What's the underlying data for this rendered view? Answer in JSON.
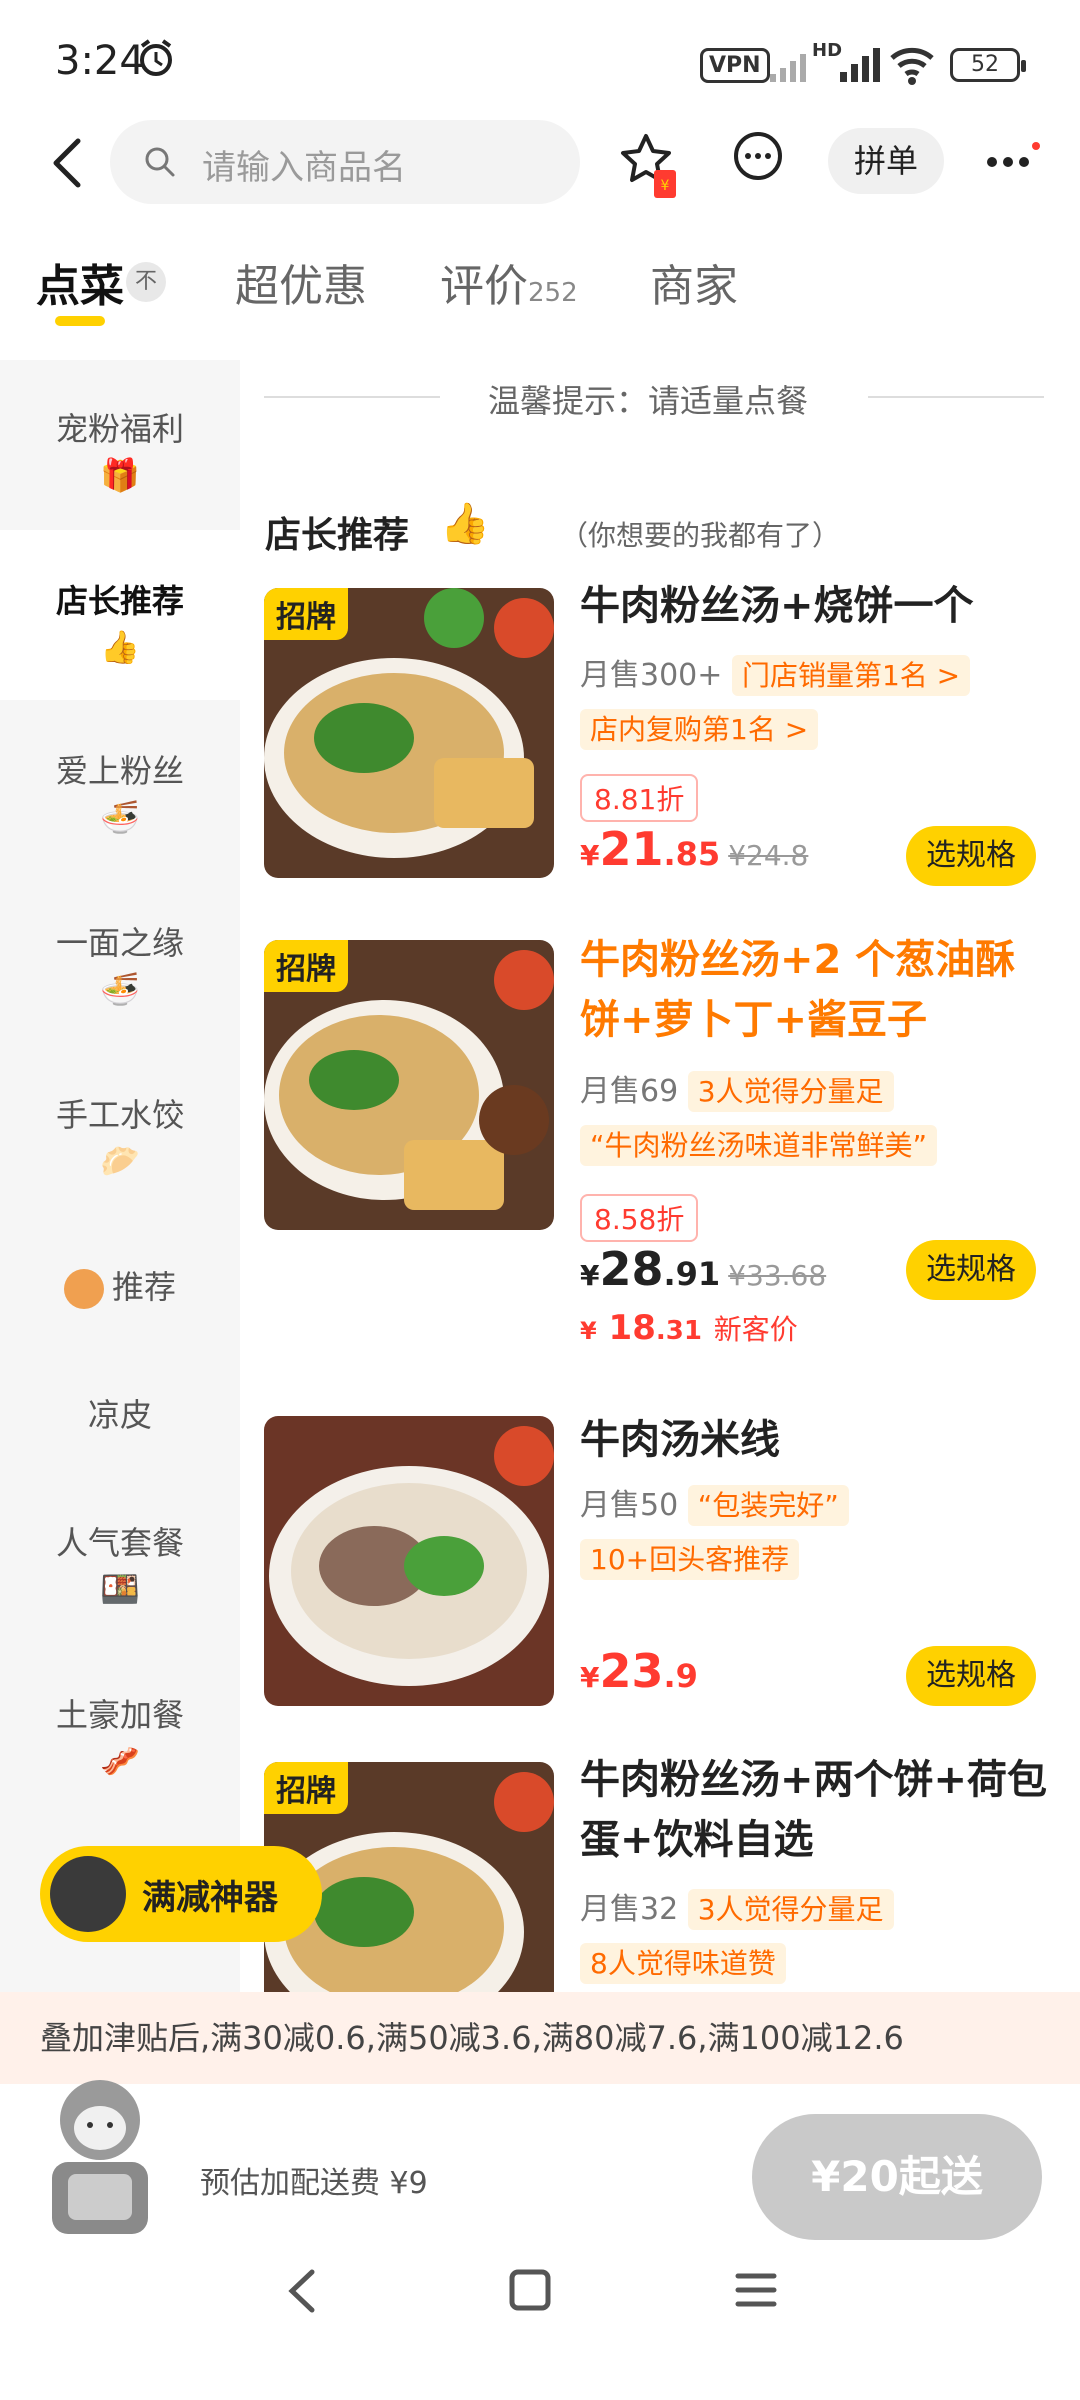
{
  "status_bar": {
    "time": "3:24",
    "vpn": "VPN",
    "hd": "HD",
    "battery": "52"
  },
  "header": {
    "search_placeholder": "请输入商品名",
    "pindan_label": "拼单"
  },
  "tabs": [
    {
      "label": "点菜",
      "active": true,
      "badge": "不"
    },
    {
      "label": "超优惠"
    },
    {
      "label": "评价",
      "count": "252"
    },
    {
      "label": "商家"
    }
  ],
  "sidebar": {
    "items": [
      {
        "label": "宠粉福利",
        "emoji": "🎁"
      },
      {
        "label": "店长推荐",
        "emoji": "👍",
        "active": true
      },
      {
        "label": "爱上粉丝",
        "emoji": "🍜"
      },
      {
        "label": "一面之缘",
        "emoji": "🍜"
      },
      {
        "label": "手工水饺",
        "emoji": "🥟"
      },
      {
        "label": "推荐"
      },
      {
        "label": "凉皮"
      },
      {
        "label": "人气套餐",
        "emoji": "🍱"
      },
      {
        "label": "土豪加餐",
        "emoji": "🥓"
      }
    ]
  },
  "content": {
    "tip": "温馨提示：请适量点餐",
    "section_title": "店长推荐",
    "section_emoji": "👍",
    "section_sub": "（你想要的我都有了）",
    "products": [
      {
        "tag": "招牌",
        "name": "牛肉粉丝汤+烧饼一个",
        "monthly": "月售300+",
        "chips": [
          "门店销量第1名 >",
          "店内复购第1名 >"
        ],
        "discount": "8.81折",
        "price_int": "21",
        "price_dec": ".85",
        "price_orig": "¥24.8",
        "button": "选规格"
      },
      {
        "tag": "招牌",
        "name": "牛肉粉丝汤+2 个葱油酥饼+萝卜丁+酱豆子",
        "monthly": "月售69",
        "chips": [
          "3人觉得分量足",
          "“牛肉粉丝汤味道非常鲜美”"
        ],
        "discount": "8.58折",
        "price_int": "28",
        "price_dec": ".91",
        "price_orig": "¥33.68",
        "new_int": "18",
        "new_dec": ".31",
        "new_label": "新客价",
        "button": "选规格"
      },
      {
        "name": "牛肉汤米线",
        "monthly": "月售50",
        "chips": [
          "“包装完好”",
          "10+回头客推荐"
        ],
        "price_int": "23",
        "price_dec": ".9",
        "button": "选规格"
      },
      {
        "tag": "招牌",
        "name": "牛肉粉丝汤+两个饼+荷包蛋+饮料自选",
        "monthly": "月售32",
        "chips": [
          "3人觉得分量足",
          "8人觉得味道赞"
        ]
      }
    ],
    "currency": "¥"
  },
  "fab": {
    "label": "满减神器"
  },
  "promo": {
    "text": "叠加津贴后,满30减0.6,满50减3.6,满80减7.6,满100减12.6"
  },
  "cart": {
    "fee": "预估加配送费 ¥9",
    "min_order": "¥20起送"
  },
  "colors": {
    "accent": "#ffd100",
    "price": "#ff3b30",
    "orange": "#ff7a00"
  }
}
